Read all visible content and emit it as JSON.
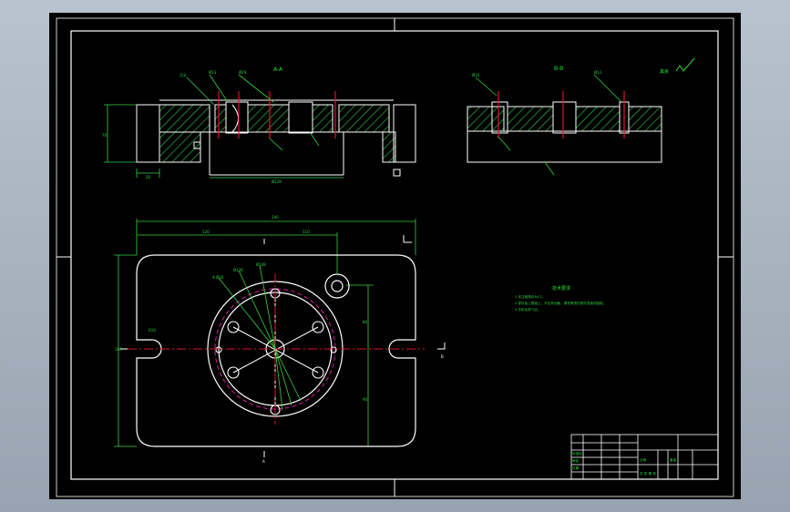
{
  "colors": {
    "background": "#000000",
    "frame": "#ffffff",
    "outline": "#ffffff",
    "hatch": "#2ed14a",
    "dimension": "#35d23f",
    "centerline": "#e0152b",
    "hidden_circle": "#d8189f",
    "text_green": "#27e23a",
    "notes": "#30d040"
  },
  "views": {
    "section_a_label": "A-A",
    "section_b_label": "B-B",
    "mark_a": "A",
    "mark_b": "B"
  },
  "plan": {
    "dim_overall_width": "240",
    "dim_left": "120",
    "dim_right": "110"
  },
  "notes": {
    "title": "技术要求",
    "lines": [
      "1.未注倒角均为C1。",
      "2.零件加工表面上，不应有划痕、擦伤等损伤零件表面的缺陷。",
      "3.去除毛刺飞边。"
    ]
  },
  "roughness_note": "其余 ",
  "title_block": {
    "title_cells": [
      "标准化",
      "审定",
      "日期"
    ],
    "scale_label": "比例",
    "weight_label": "重量",
    "sheet_label": "共 张 第 张"
  }
}
